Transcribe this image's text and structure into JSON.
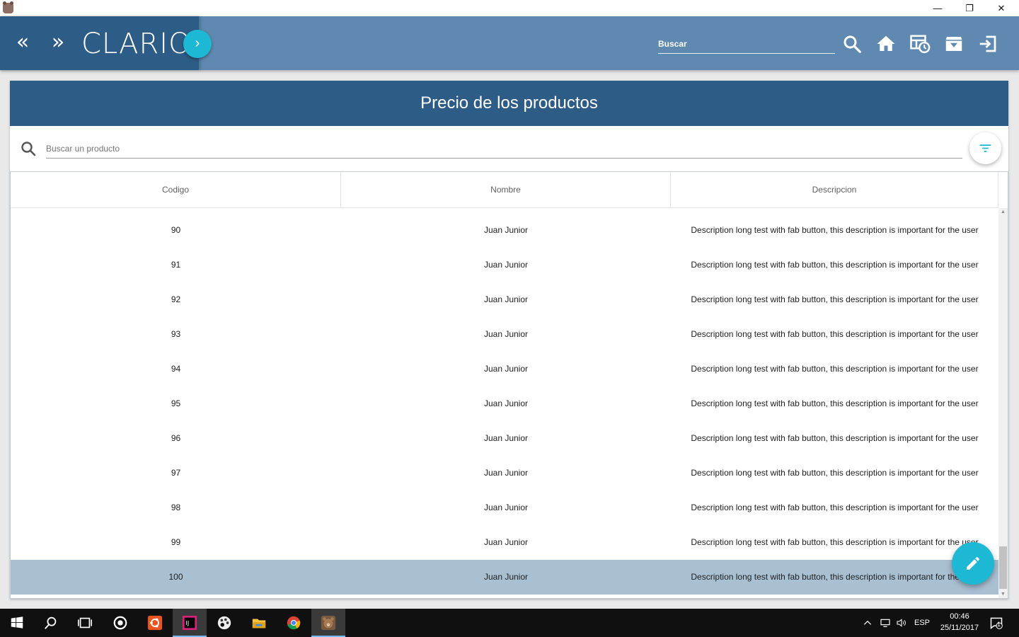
{
  "window": {
    "minimize_glyph": "—",
    "maximize_glyph": "❐",
    "close_glyph": "✕"
  },
  "header": {
    "prev_glyph": "«",
    "next_glyph": "»",
    "brand": "CLARIO",
    "brand_fab_glyph": "›",
    "search_placeholder": "Buscar",
    "icons": [
      "search-icon",
      "home-icon",
      "history-table-icon",
      "archive-icon",
      "logout-icon"
    ]
  },
  "card": {
    "title": "Precio de los productos",
    "search_placeholder": "Buscar un producto"
  },
  "table": {
    "columns": [
      "Codigo",
      "Nombre",
      "Descripcion"
    ],
    "rows": [
      {
        "codigo": "90",
        "nombre": "Juan Junior",
        "descripcion": "Description long test with fab button, this description is important for the user"
      },
      {
        "codigo": "91",
        "nombre": "Juan Junior",
        "descripcion": "Description long test with fab button, this description is important for the user"
      },
      {
        "codigo": "92",
        "nombre": "Juan Junior",
        "descripcion": "Description long test with fab button, this description is important for the user"
      },
      {
        "codigo": "93",
        "nombre": "Juan Junior",
        "descripcion": "Description long test with fab button, this description is important for the user"
      },
      {
        "codigo": "94",
        "nombre": "Juan Junior",
        "descripcion": "Description long test with fab button, this description is important for the user"
      },
      {
        "codigo": "95",
        "nombre": "Juan Junior",
        "descripcion": "Description long test with fab button, this description is important for the user"
      },
      {
        "codigo": "96",
        "nombre": "Juan Junior",
        "descripcion": "Description long test with fab button, this description is important for the user"
      },
      {
        "codigo": "97",
        "nombre": "Juan Junior",
        "descripcion": "Description long test with fab button, this description is important for the user"
      },
      {
        "codigo": "98",
        "nombre": "Juan Junior",
        "descripcion": "Description long test with fab button, this description is important for the user"
      },
      {
        "codigo": "99",
        "nombre": "Juan Junior",
        "descripcion": "Description long test with fab button, this description is important for the user"
      },
      {
        "codigo": "100",
        "nombre": "Juan Junior",
        "descripcion": "Description long test with fab button, this description is important for the user",
        "selected": true
      }
    ],
    "scroll_up_glyph": "▲",
    "scroll_down_glyph": "▼"
  },
  "colors": {
    "header_bg": "#5f89b0",
    "brand_bg": "#2d5d86",
    "accent": "#1cb8d4",
    "selected_row": "#a9bfd2"
  },
  "taskbar": {
    "language": "ESP",
    "time": "00:46",
    "date": "25/11/2017",
    "notification_count": "1"
  }
}
